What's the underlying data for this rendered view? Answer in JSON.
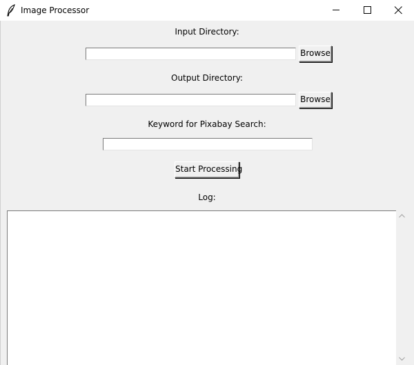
{
  "window": {
    "title": "Image Processor",
    "icon": "feather-icon",
    "controls": [
      "minimize-icon",
      "maximize-icon",
      "close-icon"
    ]
  },
  "input_directory": {
    "label": "Input Directory:",
    "value": "",
    "browse_label": "Browse"
  },
  "output_directory": {
    "label": "Output Directory:",
    "value": "",
    "browse_label": "Browse"
  },
  "keyword": {
    "label": "Keyword for Pixabay Search:",
    "value": ""
  },
  "start_button": {
    "label": "Start Processing"
  },
  "log": {
    "label": "Log:",
    "content": ""
  }
}
